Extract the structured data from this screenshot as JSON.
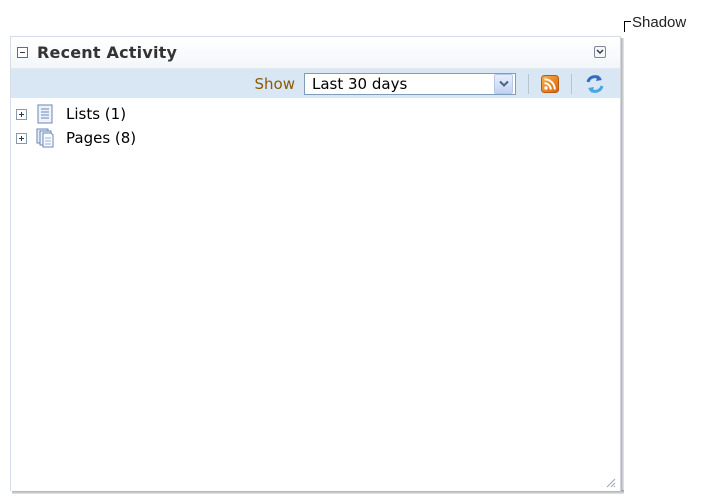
{
  "annotation": {
    "label": "Shadow"
  },
  "panel": {
    "title": "Recent Activity",
    "collapse_icon": "minus-box-icon",
    "menu_icon": "chevron-down-icon"
  },
  "toolbar": {
    "show_label": "Show",
    "range_select": {
      "value": "Last 30 days"
    },
    "rss_icon": "rss-feed-icon",
    "refresh_icon": "refresh-icon",
    "colors": {
      "toolbar_bg": "#d9e7f5",
      "show_label": "#8a5a00"
    }
  },
  "tree": {
    "items": [
      {
        "label": "Lists (1)",
        "icon": "list-document-icon"
      },
      {
        "label": "Pages (8)",
        "icon": "pages-stack-icon"
      }
    ]
  }
}
